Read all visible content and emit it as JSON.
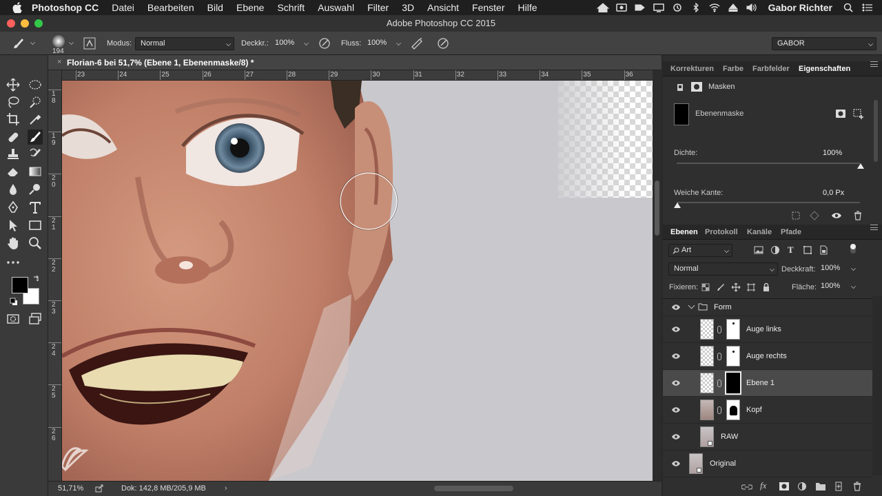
{
  "menubar": {
    "items": [
      "Photoshop CC",
      "Datei",
      "Bearbeiten",
      "Bild",
      "Ebene",
      "Schrift",
      "Auswahl",
      "Filter",
      "3D",
      "Ansicht",
      "Fenster",
      "Hilfe"
    ],
    "user": "Gabor Richter"
  },
  "window": {
    "title": "Adobe Photoshop CC 2015"
  },
  "options": {
    "brush_size": "194",
    "mode_label": "Modus:",
    "mode_value": "Normal",
    "opacity_label": "Deckkr.:",
    "opacity_value": "100%",
    "flow_label": "Fluss:",
    "flow_value": "100%",
    "workspace": "GABOR"
  },
  "document": {
    "tab_title": "Florian-6 bei 51,7% (Ebene 1, Ebenenmaske/8) *",
    "close": "×",
    "ruler_h": [
      "23",
      "24",
      "25",
      "26",
      "27",
      "28",
      "29",
      "30",
      "31",
      "32",
      "33",
      "34",
      "35",
      "36"
    ],
    "ruler_v": [
      "1\n8",
      "1\n9",
      "2\n0",
      "2\n1",
      "2\n2",
      "2\n3",
      "2\n4",
      "2\n5",
      "2\n6"
    ]
  },
  "status": {
    "zoom": "51,71%",
    "doc": "Dok: 142,8 MB/205,9 MB"
  },
  "properties": {
    "tabs": [
      "Korrekturen",
      "Farbe",
      "Farbfelder",
      "Eigenschaften"
    ],
    "active_tab": "Eigenschaften",
    "section": "Masken",
    "mask_label": "Ebenenmaske",
    "density_label": "Dichte:",
    "density_value": "100%",
    "density": 1.0,
    "feather_label": "Weiche Kante:",
    "feather_value": "0,0 Px",
    "feather": 0.0
  },
  "layers_panel": {
    "tabs": [
      "Ebenen",
      "Protokoll",
      "Kanäle",
      "Pfade"
    ],
    "active_tab": "Ebenen",
    "filter_label": "Art",
    "blend_mode": "Normal",
    "opacity_label": "Deckkraft:",
    "opacity_value": "100%",
    "lock_label": "Fixieren:",
    "fill_label": "Fläche:",
    "fill_value": "100%",
    "layers": [
      {
        "name": "Form",
        "type": "group"
      },
      {
        "name": "Auge links",
        "type": "mask"
      },
      {
        "name": "Auge rechts",
        "type": "mask"
      },
      {
        "name": "Ebene 1",
        "type": "mask-black",
        "selected": true
      },
      {
        "name": "Kopf",
        "type": "mask"
      },
      {
        "name": "RAW",
        "type": "smart"
      },
      {
        "name": "Original",
        "type": "smart"
      }
    ]
  },
  "colors": {
    "foreground": "#000000",
    "background": "#ffffff",
    "ui_dark": "#2f2f2f"
  }
}
